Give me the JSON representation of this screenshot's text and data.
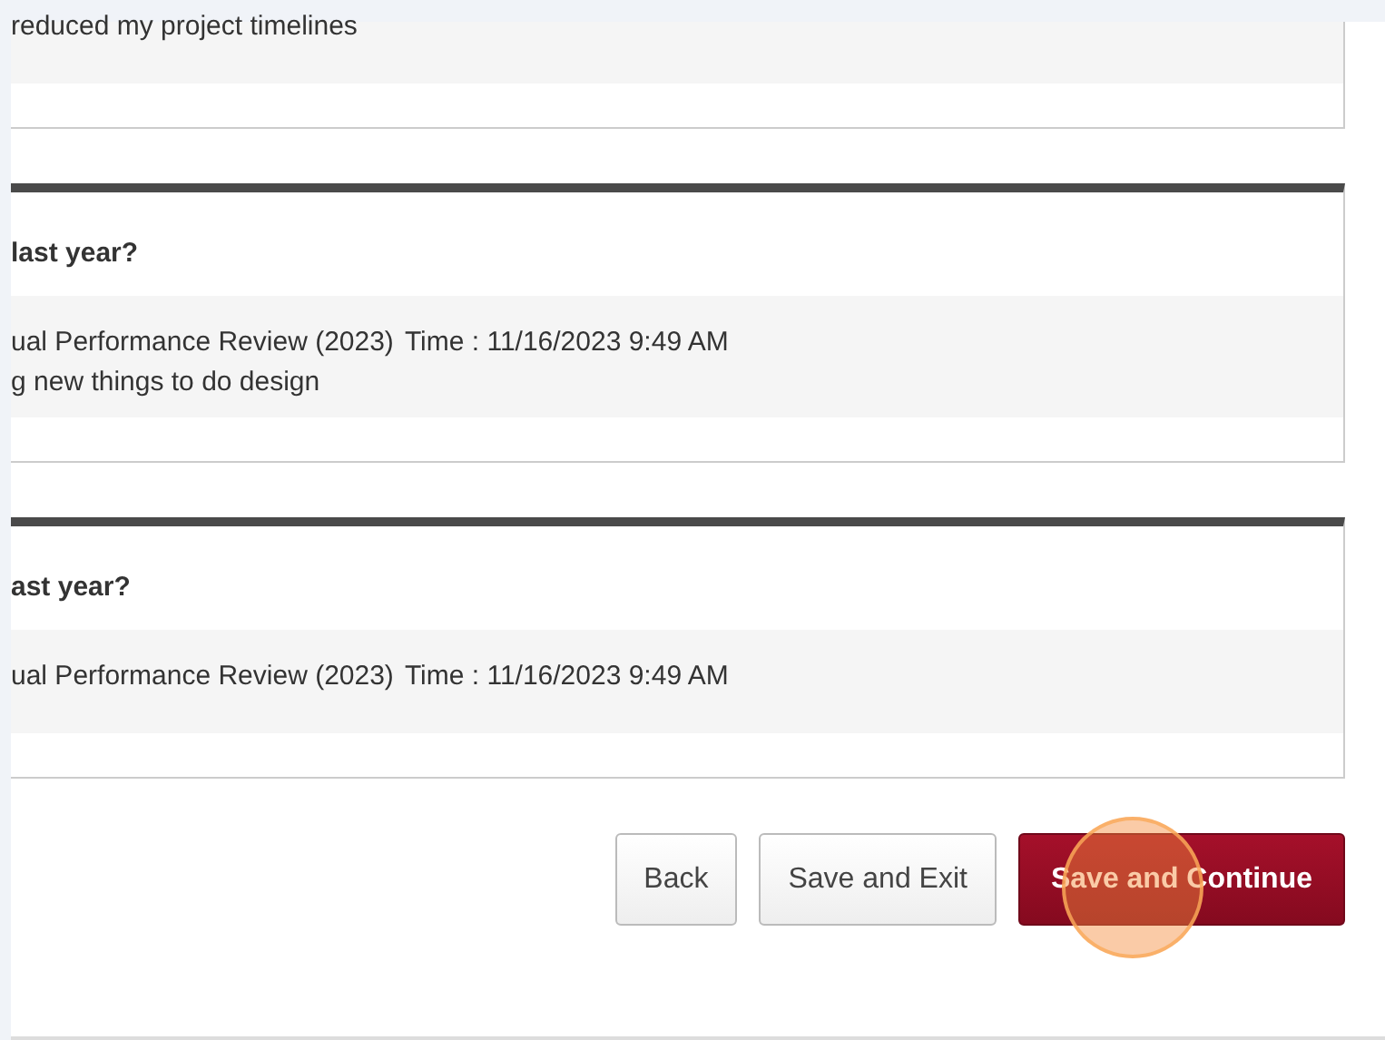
{
  "responses": [
    {
      "kind": "partial",
      "answer": "reduced my project timelines"
    },
    {
      "kind": "full",
      "question": "last year?",
      "review": "ual Performance Review (2023)",
      "time": "Time : 11/16/2023 9:49 AM",
      "answer": "g new things to do design"
    },
    {
      "kind": "full",
      "question": "ast year?",
      "review": "ual Performance Review (2023)",
      "time": "Time : 11/16/2023 9:49 AM"
    }
  ],
  "buttons": [
    {
      "label": "Back",
      "kind": "secondary"
    },
    {
      "label": "Save and Exit",
      "kind": "secondary"
    },
    {
      "label": "Save and Continue",
      "kind": "primary"
    }
  ]
}
